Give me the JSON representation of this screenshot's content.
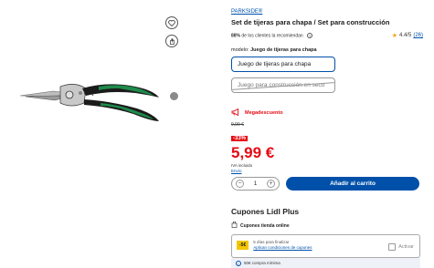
{
  "brand": "PARKSIDE®",
  "title": "Set de tijeras para chapa / Set para construcción",
  "reco": {
    "percent": "88%",
    "text": "de los clientes la recomiendan"
  },
  "rating": {
    "score": "4.4/5",
    "count": "(26)"
  },
  "model": {
    "label": "modelo:",
    "value": "Juego de tijeras para chapa"
  },
  "options": [
    {
      "label": "Juego de tijeras para chapa"
    },
    {
      "label": "Juego para construcción en seco"
    }
  ],
  "promo": {
    "label": "Megadescuento"
  },
  "price": {
    "old": "9,99 €",
    "discount": "-33%",
    "current": "5,99 €",
    "vat": "IVA incluido",
    "shipping": "Envío"
  },
  "cart": {
    "qty": "1",
    "minus": "−",
    "plus": "+",
    "add_label": "Añadir al carrito"
  },
  "coupons": {
    "title": "Cupones Lidl Plus",
    "subtitle": "Cupones tienda online",
    "badge": "-5€",
    "days": "5 días para finalizar",
    "conditions": "Aplican condiciones de cupones",
    "activate": "Activar",
    "minimum": "50€ compra mínima"
  },
  "icons": [
    "heart-icon",
    "share-icon",
    "next-image-icon",
    "star-icon",
    "megaphone-icon",
    "shopping-bag-icon",
    "info-icon"
  ],
  "colors": {
    "accent": "#0050aa",
    "sale": "#e60a14",
    "coupon": "#f2c600"
  }
}
